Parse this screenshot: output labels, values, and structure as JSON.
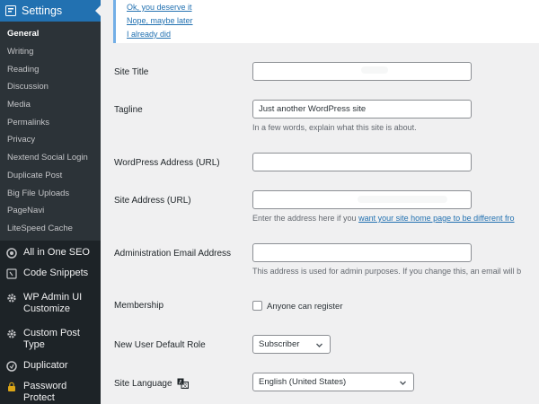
{
  "sidebar": {
    "settings_label": "Settings",
    "submenu": [
      {
        "label": "General",
        "active": true
      },
      {
        "label": "Writing"
      },
      {
        "label": "Reading"
      },
      {
        "label": "Discussion"
      },
      {
        "label": "Media"
      },
      {
        "label": "Permalinks"
      },
      {
        "label": "Privacy"
      },
      {
        "label": "Nextend Social Login"
      },
      {
        "label": "Duplicate Post"
      },
      {
        "label": "Big File Uploads"
      },
      {
        "label": "PageNavi"
      },
      {
        "label": "LiteSpeed Cache"
      }
    ],
    "menu": [
      {
        "label": "All in One SEO",
        "icon": "aioseo-icon"
      },
      {
        "label": "Code Snippets",
        "icon": "code-snippets-icon"
      },
      {
        "label": "WP Admin UI Customize",
        "icon": "gear-icon"
      },
      {
        "label": "Custom Post Type",
        "icon": "gear-icon"
      },
      {
        "label": "Duplicator",
        "icon": "duplicator-icon"
      },
      {
        "label": "Password Protect WordPress",
        "icon": "lock-icon"
      }
    ]
  },
  "notice": {
    "links": [
      "Ok, you deserve it",
      "Nope, maybe later",
      "I already did"
    ]
  },
  "form": {
    "site_title": {
      "label": "Site Title",
      "value": ""
    },
    "tagline": {
      "label": "Tagline",
      "value": "Just another WordPress site",
      "description": "In a few words, explain what this site is about."
    },
    "wp_address": {
      "label": "WordPress Address (URL)",
      "value": ""
    },
    "site_address": {
      "label": "Site Address (URL)",
      "value": "",
      "description_prefix": "Enter the address here if you ",
      "description_link": "want your site home page to be different fro"
    },
    "admin_email": {
      "label": "Administration Email Address",
      "value": "",
      "description": "This address is used for admin purposes. If you change this, an email will b"
    },
    "membership": {
      "label": "Membership",
      "checkbox_label": "Anyone can register",
      "checked": false
    },
    "default_role": {
      "label": "New User Default Role",
      "value": "Subscriber"
    },
    "site_language": {
      "label": "Site Language",
      "value": "English (United States)",
      "icon": "translation-icon"
    }
  },
  "colors": {
    "sidebar_bg": "#1d2327",
    "submenu_bg": "#2c3338",
    "accent": "#2271b1",
    "notice_border": "#72aee6"
  }
}
